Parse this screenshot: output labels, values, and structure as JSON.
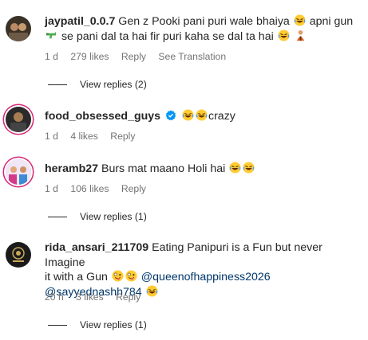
{
  "comments": [
    {
      "username": "jaypatil_0.0.7",
      "text_parts": [
        "Gen z Pooki pani puri wale bhaiya",
        "apni gun",
        "se pani dal ta hai fir puri kaha se dal ta hai"
      ],
      "time": "1 d",
      "likes": "279 likes",
      "reply": "Reply",
      "translate": "See Translation",
      "view_replies": "View replies (2)"
    },
    {
      "username": "food_obsessed_guys",
      "text": "crazy",
      "time": "1 d",
      "likes": "4 likes",
      "reply": "Reply"
    },
    {
      "username": "heramb27",
      "text": "Burs mat maano Holi hai",
      "time": "1 d",
      "likes": "106 likes",
      "reply": "Reply",
      "view_replies": "View replies (1)"
    },
    {
      "username": "rida_ansari_211709",
      "text_line1": "Eating Panipuri is a Fun but never Imagine",
      "text_line2": "it with a Gun",
      "mention1": "@queenofhappiness2026",
      "mention2": "@sayyednashh784",
      "time": "20 h",
      "likes": "3 likes",
      "reply": "Reply",
      "view_replies": "View replies (1)"
    }
  ],
  "icons": {
    "laugh": "face-with-tears-of-joy-icon",
    "squint": "zany-face-icon",
    "gun": "water-pistol-icon",
    "person": "person-icon",
    "verified": "verified-badge-icon"
  },
  "colors": {
    "mention": "#00376b",
    "meta": "#737373",
    "verified": "#0095f6"
  }
}
